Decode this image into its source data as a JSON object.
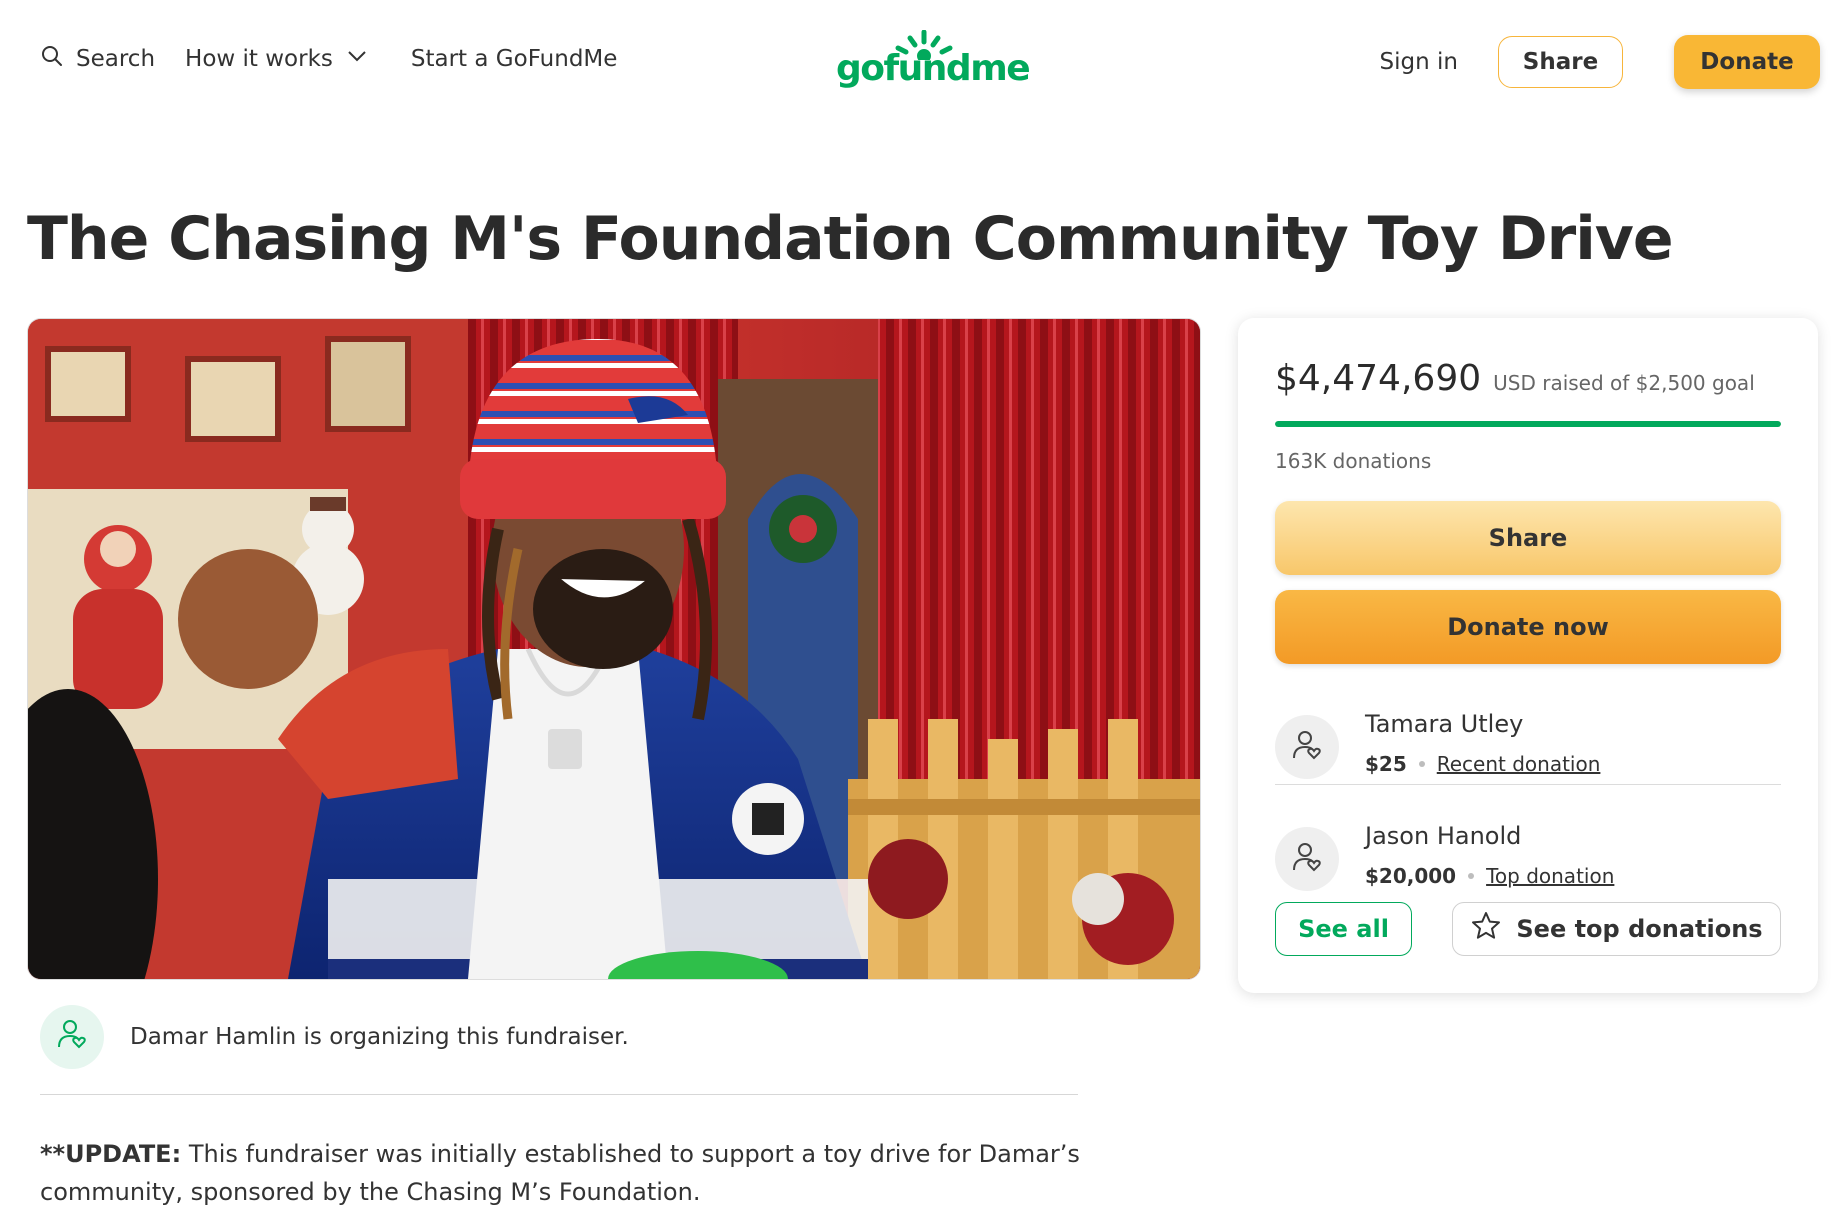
{
  "header": {
    "search_label": "Search",
    "how_it_works_label": "How it works",
    "start_label": "Start a GoFundMe",
    "logo_text": "gofundme",
    "signin_label": "Sign in",
    "share_label": "Share",
    "donate_label": "Donate"
  },
  "page": {
    "title": "The Chasing M's Foundation Community Toy Drive"
  },
  "organizer": {
    "text": "Damar Hamlin is organizing this fundraiser."
  },
  "story": {
    "update_bold": "**UPDATE:",
    "update_text": " This fundraiser was initially established to support a toy drive for Damar’s community, sponsored by the Chasing M’s Foundation."
  },
  "card": {
    "raised_amount": "$4,474,690",
    "raised_sub": "USD raised of $2,500 goal",
    "progress_fraction": 1.0,
    "donation_count": "163K donations",
    "share_label": "Share",
    "donate_label": "Donate now",
    "donors": [
      {
        "name": "Tamara Utley",
        "amount": "$25",
        "tag": "Recent donation"
      },
      {
        "name": "Jason Hanold",
        "amount": "$20,000",
        "tag": "Top donation"
      }
    ],
    "see_all_label": "See all",
    "see_top_label": "See top donations"
  },
  "colors": {
    "brand_green": "#02a95c",
    "donate_orange": "#f9b735"
  },
  "icons": {
    "search": "search-icon",
    "chevron": "chevron-down-icon",
    "user_heart": "user-heart-icon",
    "star": "star-icon"
  }
}
